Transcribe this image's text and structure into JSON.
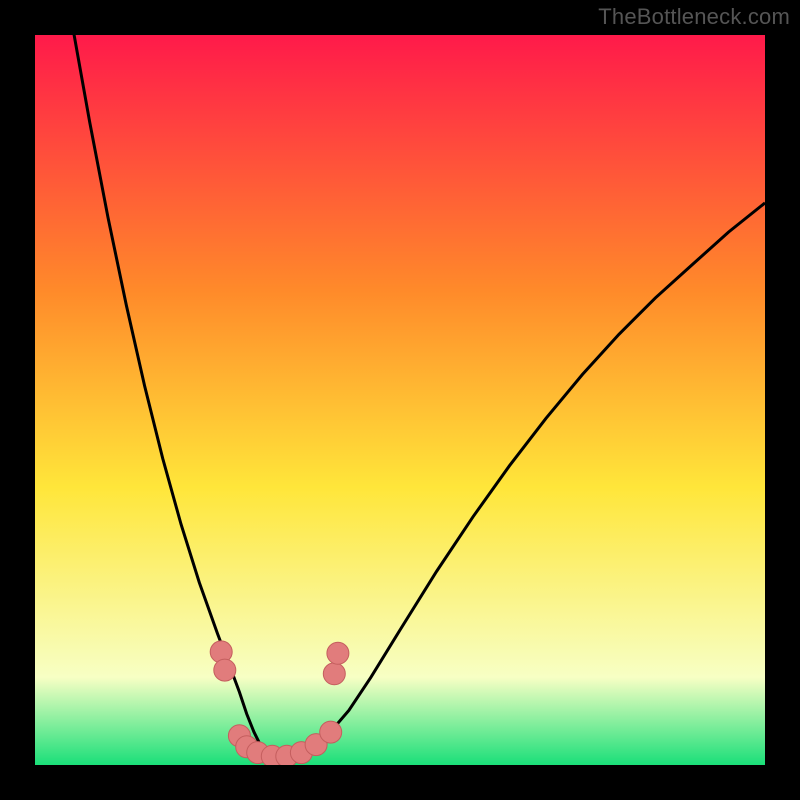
{
  "watermark": "TheBottleneck.com",
  "colors": {
    "frame_bg": "#000000",
    "curve": "#000000",
    "marker_fill": "#e17c7c",
    "marker_stroke": "#c45e5e",
    "gradient_top": "#ff1a4a",
    "gradient_mid_upper": "#ff8a2a",
    "gradient_mid": "#ffe63a",
    "gradient_lower": "#f7ffc4",
    "gradient_bottom": "#1adf79"
  },
  "chart_data": {
    "type": "line",
    "title": "",
    "xlabel": "",
    "ylabel": "",
    "xlim": [
      0,
      100
    ],
    "ylim": [
      0,
      100
    ],
    "x": [
      0,
      2.5,
      5,
      7.5,
      10,
      12.5,
      15,
      17.5,
      20,
      22.5,
      25,
      26.5,
      28,
      29,
      30,
      31,
      32,
      34,
      36,
      38,
      40,
      43,
      46,
      50,
      55,
      60,
      65,
      70,
      75,
      80,
      85,
      90,
      95,
      100
    ],
    "series": [
      {
        "name": "bottleneck-curve",
        "values": [
          135,
          118,
          102,
          88,
          75,
          63,
          52,
          42,
          33,
          25,
          18,
          14,
          10,
          7,
          4.5,
          2.5,
          1.5,
          1,
          1.2,
          2,
          4,
          7.5,
          12,
          18.5,
          26.5,
          34,
          41,
          47.5,
          53.5,
          59,
          64,
          68.5,
          73,
          77
        ]
      }
    ],
    "markers": {
      "name": "highlighted-points",
      "points": [
        {
          "x": 25.5,
          "y": 15.5
        },
        {
          "x": 26.0,
          "y": 13.0
        },
        {
          "x": 28.0,
          "y": 4.0
        },
        {
          "x": 29.0,
          "y": 2.5
        },
        {
          "x": 30.5,
          "y": 1.7
        },
        {
          "x": 32.5,
          "y": 1.2
        },
        {
          "x": 34.5,
          "y": 1.2
        },
        {
          "x": 36.5,
          "y": 1.7
        },
        {
          "x": 38.5,
          "y": 2.8
        },
        {
          "x": 40.5,
          "y": 4.5
        },
        {
          "x": 41.0,
          "y": 12.5
        },
        {
          "x": 41.5,
          "y": 15.3
        }
      ]
    }
  }
}
